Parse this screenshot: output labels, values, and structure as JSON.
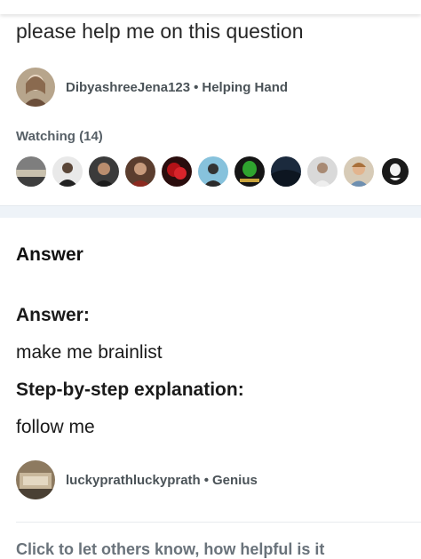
{
  "question": {
    "text": "please help me on this question",
    "asker": {
      "username": "DibyashreeJena123",
      "separator": "•",
      "rank": "Helping Hand"
    },
    "watching_label": "Watching (14)",
    "watcher_avatars": [
      "avatar",
      "avatar",
      "avatar",
      "avatar",
      "avatar",
      "avatar",
      "avatar",
      "avatar",
      "avatar",
      "avatar",
      "avatar",
      "avatar"
    ]
  },
  "answer": {
    "section_title": "Answer",
    "answer_label": "Answer:",
    "answer_text": "make me brainlist",
    "explanation_label": "Step-by-step explanation:",
    "explanation_text": "follow me",
    "answerer": {
      "username": "luckyprathluckyprath",
      "separator": "•",
      "rank": "Genius"
    }
  },
  "footer": {
    "rate_prompt": "Click to let others know, how helpful is it"
  },
  "colors": {
    "background": "#ffffff",
    "band": "#eef3f8",
    "username_text": "#4b5358",
    "muted_text": "#6a737b"
  }
}
